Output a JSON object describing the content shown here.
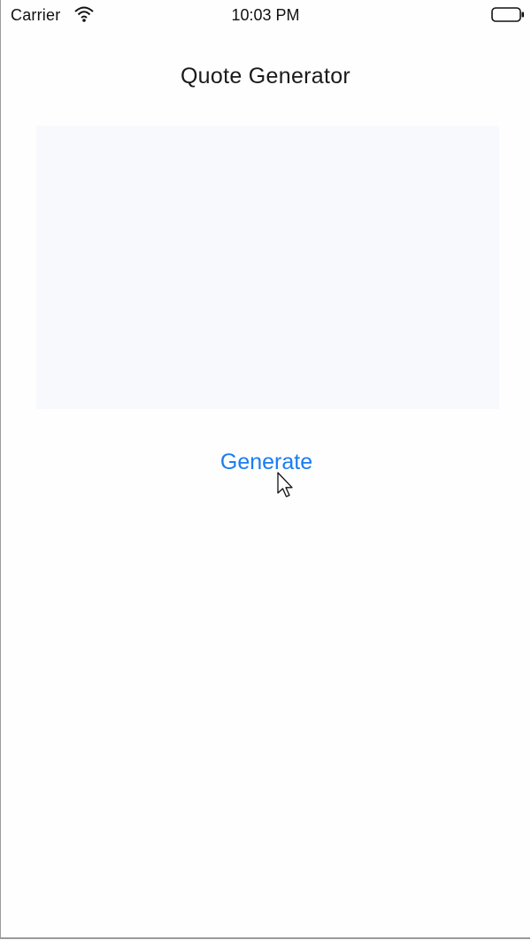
{
  "status_bar": {
    "carrier": "Carrier",
    "time": "10:03 PM",
    "wifi_icon": "wifi-icon",
    "battery_icon": "battery-icon"
  },
  "header": {
    "title": "Quote Generator"
  },
  "quote_box": {
    "text": ""
  },
  "actions": {
    "generate_label": "Generate"
  },
  "colors": {
    "accent": "#1a7cf0",
    "quote_box_background": "#f7f9fc",
    "text": "#1a1a1a"
  }
}
